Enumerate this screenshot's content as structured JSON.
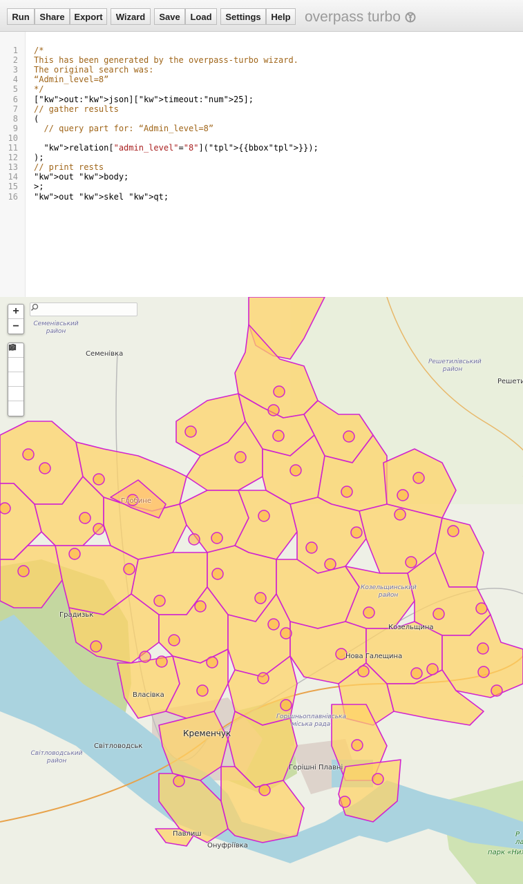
{
  "toolbar": {
    "buttons": [
      "Run",
      "Share",
      "Export",
      "Wizard",
      "Save",
      "Load",
      "Settings",
      "Help"
    ],
    "brand": "overpass turbo"
  },
  "editor": {
    "line_numbers": [
      "1",
      "2",
      "3",
      "4",
      "5",
      "6",
      "7",
      "8",
      "9",
      "10",
      "11",
      "12",
      "13",
      "14",
      "15",
      "16"
    ],
    "lines": [
      "/*",
      "This has been generated by the overpass-turbo wizard.",
      "The original search was:",
      "“Admin_level=8”",
      "*/",
      "[out:json][timeout:25];",
      "// gather results",
      "(",
      "  // query part for: “Admin_level=8”",
      "",
      "  relation[\"admin_level\"=\"8\"]({{bbox}});",
      ");",
      "// print rests",
      "out body;",
      ">;",
      "out skel qt;"
    ]
  },
  "map": {
    "search_placeholder": "",
    "zoom_in": "+",
    "zoom_out": "−",
    "labels": {
      "semenivskyi_raion": "Семенівський район",
      "semenivka": "Семенівка",
      "reshetylivskyi_raion": "Решетилівський район",
      "reshetylivka": "Решетил",
      "hlobyne": "Глобине",
      "hradyzk": "Градизьк",
      "kozelshchynskyi_raion": "Козельщинський район",
      "kozelshchyna": "Козельщина",
      "nova_haleshchyna": "Нова Галещина",
      "vlasivka": "Власівка",
      "kremenchuk": "Кременчук",
      "svitlovodsk": "Світловодськ",
      "svitlovodskyi_raion": "Світловодський район",
      "horishni_plavni_rada": "Горішньоплавнівська міська рада",
      "horishni_plavni": "Горішні Плавні",
      "pavlysh": "Павлиш",
      "onufriivka": "Онуфріївка",
      "park": "парк «Ниж",
      "park_partial": "Р ла"
    },
    "colors": {
      "polygon_fill": "#ffd265",
      "polygon_stroke": "#d024d0",
      "marker_stroke": "#d024d0",
      "marker_fill": "#ffb03a",
      "water": "#aad3df",
      "forest": "#c6dda2",
      "urban": "#d9d0c9"
    }
  }
}
